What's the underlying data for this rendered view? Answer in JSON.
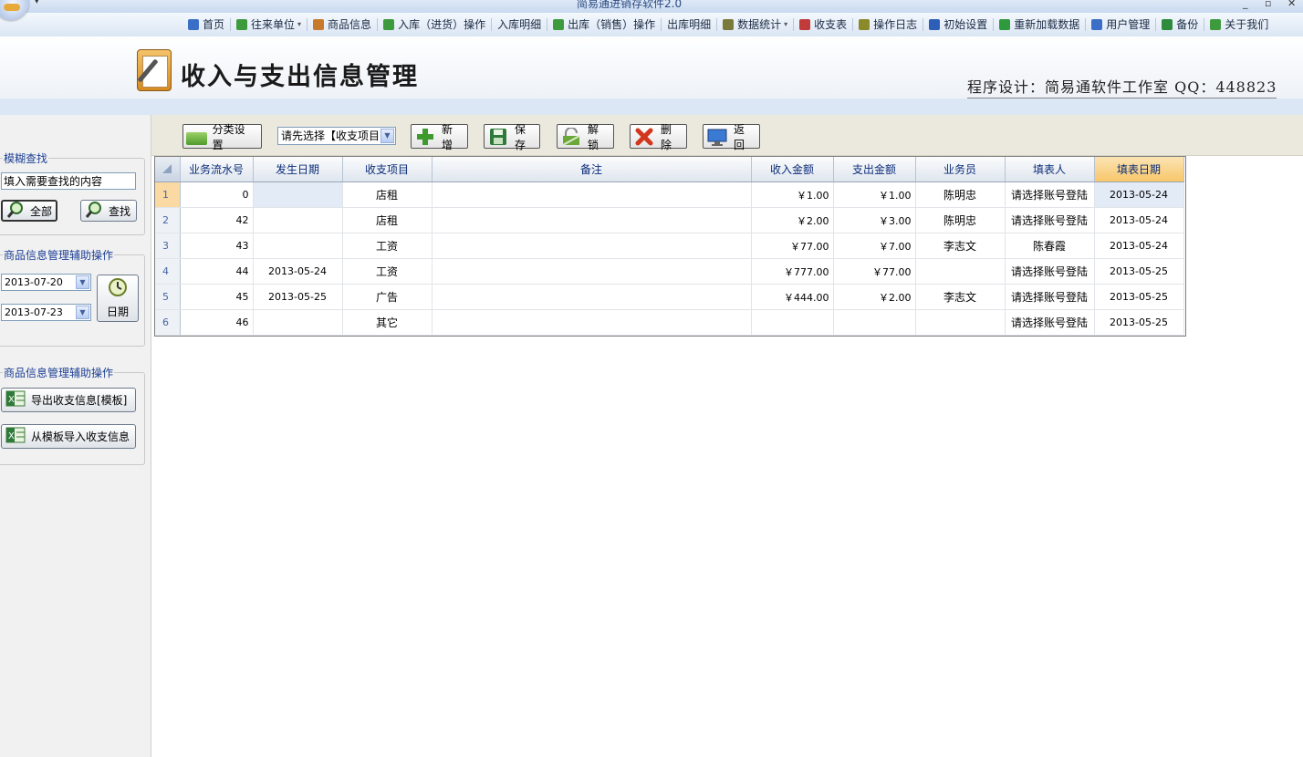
{
  "window": {
    "title": "简易通进销存软件2.0",
    "quick_access": "▾",
    "controls": [
      "_",
      "▫",
      "✕"
    ]
  },
  "menu": [
    {
      "label": "首页",
      "icon": "monitor-icon",
      "color": "#3b6fc7"
    },
    {
      "label": "往来单位",
      "icon": "recycle-icon",
      "color": "#3d9a3d",
      "dropdown": true
    },
    {
      "label": "商品信息",
      "icon": "clipboard-icon",
      "color": "#c77a2b"
    },
    {
      "label": "入库（进货）操作",
      "icon": "arrow-down-icon",
      "color": "#3d9a3d"
    },
    {
      "label": "入库明细",
      "icon": "",
      "color": ""
    },
    {
      "label": "出库（销售）操作",
      "icon": "arrow-up-icon",
      "color": "#3d9a3d"
    },
    {
      "label": "出库明细",
      "icon": "",
      "color": ""
    },
    {
      "label": "数据统计",
      "icon": "pencil-chart-icon",
      "color": "#7a7a3a",
      "dropdown": true
    },
    {
      "label": "收支表",
      "icon": "bar-chart-icon",
      "color": "#c23b3b"
    },
    {
      "label": "操作日志",
      "icon": "clock-icon",
      "color": "#8a8a2a"
    },
    {
      "label": "初始设置",
      "icon": "globe-icon",
      "color": "#2e5fb8"
    },
    {
      "label": "重新加载数据",
      "icon": "reload-icon",
      "color": "#2e9a3d"
    },
    {
      "label": "用户管理",
      "icon": "users-icon",
      "color": "#3b6fc7"
    },
    {
      "label": "备份",
      "icon": "floppy-icon",
      "color": "#2e8a3d"
    },
    {
      "label": "关于我们",
      "icon": "people-icon",
      "color": "#3d9a3d"
    }
  ],
  "header": {
    "title": "收入与支出信息管理",
    "credit": "程序设计：简易通软件工作室 QQ：448823"
  },
  "sidebar": {
    "fuzzy_search": {
      "legend": "模糊查找",
      "input_value": "填入需要查找的内容",
      "all_button": "全部",
      "search_button": "查找"
    },
    "date_group": {
      "legend": "商品信息管理辅助操作",
      "date_from": "2013-07-20",
      "date_to": "2013-07-23",
      "date_button": "日期"
    },
    "excel_group": {
      "legend": "商品信息管理辅助操作",
      "export_button": "导出收支信息[模板]",
      "import_button": "从模板导入收支信息"
    }
  },
  "toolbar": {
    "category_button": "分类设置",
    "combo_value": "请先选择【收支项目",
    "add_button": "新增",
    "save_button": "保存",
    "unlock_button": "解锁",
    "delete_button": "删除",
    "back_button": "返回"
  },
  "grid": {
    "columns": [
      "业务流水号",
      "发生日期",
      "收支项目",
      "备注",
      "收入金额",
      "支出金额",
      "业务员",
      "填表人",
      "填表日期"
    ],
    "rows": [
      {
        "n": "1",
        "serial": "0",
        "date": "",
        "item": "店租",
        "note": "",
        "income": "￥1.00",
        "expense": "￥1.00",
        "clerk": "陈明忠",
        "filler": "请选择账号登陆",
        "fill_date": "2013-05-24"
      },
      {
        "n": "2",
        "serial": "42",
        "date": "",
        "item": "店租",
        "note": "",
        "income": "￥2.00",
        "expense": "￥3.00",
        "clerk": "陈明忠",
        "filler": "请选择账号登陆",
        "fill_date": "2013-05-24"
      },
      {
        "n": "3",
        "serial": "43",
        "date": "",
        "item": "工资",
        "note": "",
        "income": "￥77.00",
        "expense": "￥7.00",
        "clerk": "李志文",
        "filler": "陈春霞",
        "fill_date": "2013-05-24"
      },
      {
        "n": "4",
        "serial": "44",
        "date": "2013-05-24",
        "item": "工资",
        "note": "",
        "income": "￥777.00",
        "expense": "￥77.00",
        "clerk": "",
        "filler": "请选择账号登陆",
        "fill_date": "2013-05-25"
      },
      {
        "n": "5",
        "serial": "45",
        "date": "2013-05-25",
        "item": "广告",
        "note": "",
        "income": "￥444.00",
        "expense": "￥2.00",
        "clerk": "李志文",
        "filler": "请选择账号登陆",
        "fill_date": "2013-05-25"
      },
      {
        "n": "6",
        "serial": "46",
        "date": "",
        "item": "其它",
        "note": "",
        "income": "",
        "expense": "",
        "clerk": "",
        "filler": "请选择账号登陆",
        "fill_date": "2013-05-25"
      }
    ]
  }
}
